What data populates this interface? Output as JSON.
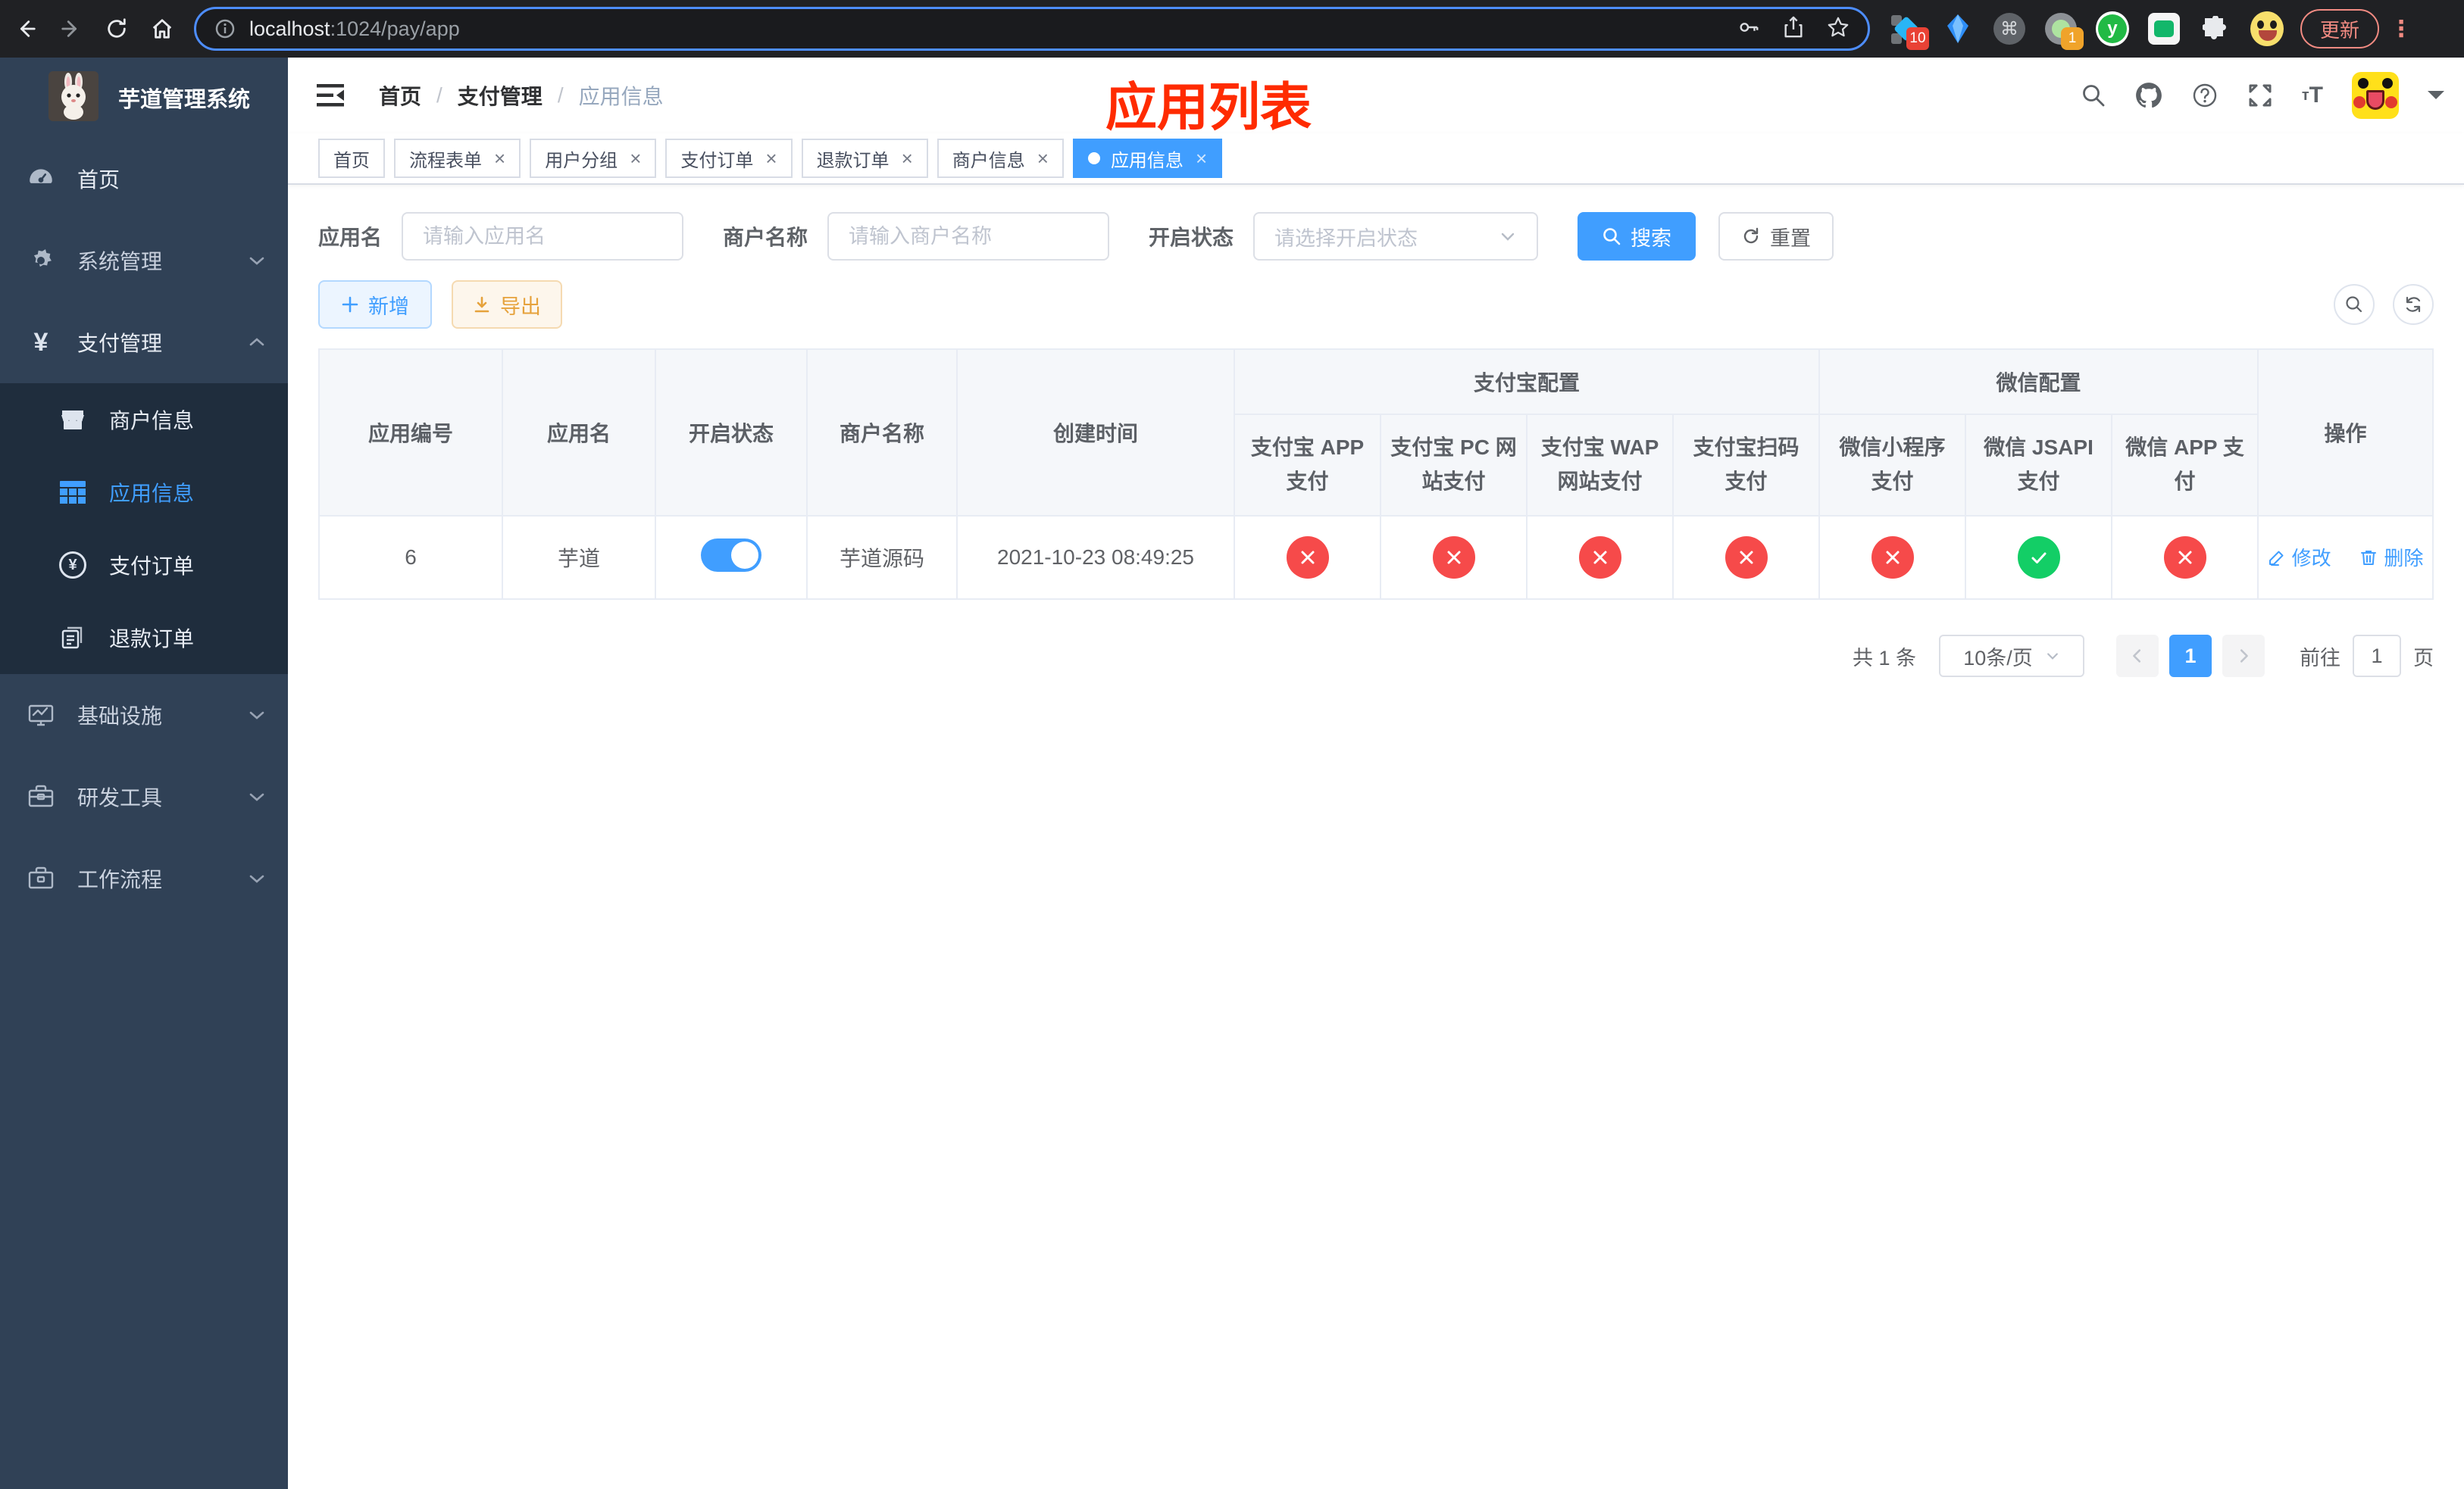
{
  "browser": {
    "host": "localhost",
    "path_rest": ":1024/pay/app",
    "update_label": "更新",
    "ext_badge_a": "10",
    "ext_badge_b": "1"
  },
  "sidebar": {
    "title": "芋道管理系统",
    "items": [
      {
        "label": "首页"
      },
      {
        "label": "系统管理"
      },
      {
        "label": "支付管理",
        "children": [
          {
            "label": "商户信息"
          },
          {
            "label": "应用信息",
            "active": true
          },
          {
            "label": "支付订单"
          },
          {
            "label": "退款订单"
          }
        ]
      },
      {
        "label": "基础设施"
      },
      {
        "label": "研发工具"
      },
      {
        "label": "工作流程"
      }
    ]
  },
  "navbar": {
    "breadcrumb": [
      "首页",
      "支付管理",
      "应用信息"
    ],
    "overlay_title": "应用列表"
  },
  "tabs": [
    {
      "label": "首页",
      "closable": false,
      "active": false
    },
    {
      "label": "流程表单",
      "closable": true,
      "active": false
    },
    {
      "label": "用户分组",
      "closable": true,
      "active": false
    },
    {
      "label": "支付订单",
      "closable": true,
      "active": false
    },
    {
      "label": "退款订单",
      "closable": true,
      "active": false
    },
    {
      "label": "商户信息",
      "closable": true,
      "active": false
    },
    {
      "label": "应用信息",
      "closable": true,
      "active": true
    }
  ],
  "filters": {
    "app_name": {
      "label": "应用名",
      "placeholder": "请输入应用名"
    },
    "merchant": {
      "label": "商户名称",
      "placeholder": "请输入商户名称"
    },
    "status": {
      "label": "开启状态",
      "placeholder": "请选择开启状态"
    },
    "search_label": "搜索",
    "reset_label": "重置"
  },
  "toolbar": {
    "add_label": "新增",
    "export_label": "导出"
  },
  "table": {
    "columns": {
      "id": "应用编号",
      "name": "应用名",
      "status": "开启状态",
      "merchant": "商户名称",
      "created": "创建时间",
      "op": "操作"
    },
    "groups": {
      "alipay": {
        "label": "支付宝配置",
        "children": [
          "支付宝 APP 支付",
          "支付宝 PC 网站支付",
          "支付宝 WAP 网站支付",
          "支付宝扫码支付"
        ]
      },
      "wechat": {
        "label": "微信配置",
        "children": [
          "微信小程序支付",
          "微信 JSAPI 支付",
          "微信 APP 支付"
        ]
      }
    },
    "row": {
      "id": "6",
      "name": "芋道",
      "enabled": true,
      "merchant": "芋道源码",
      "created_at": "2021-10-23 08:49:25",
      "configs": [
        false,
        false,
        false,
        false,
        false,
        true,
        false
      ],
      "edit_label": "修改",
      "delete_label": "删除"
    }
  },
  "pagination": {
    "total": "共 1 条",
    "page_size": "10条/页",
    "current": "1",
    "goto_label": "前往",
    "goto_value": "1",
    "unit": "页"
  }
}
